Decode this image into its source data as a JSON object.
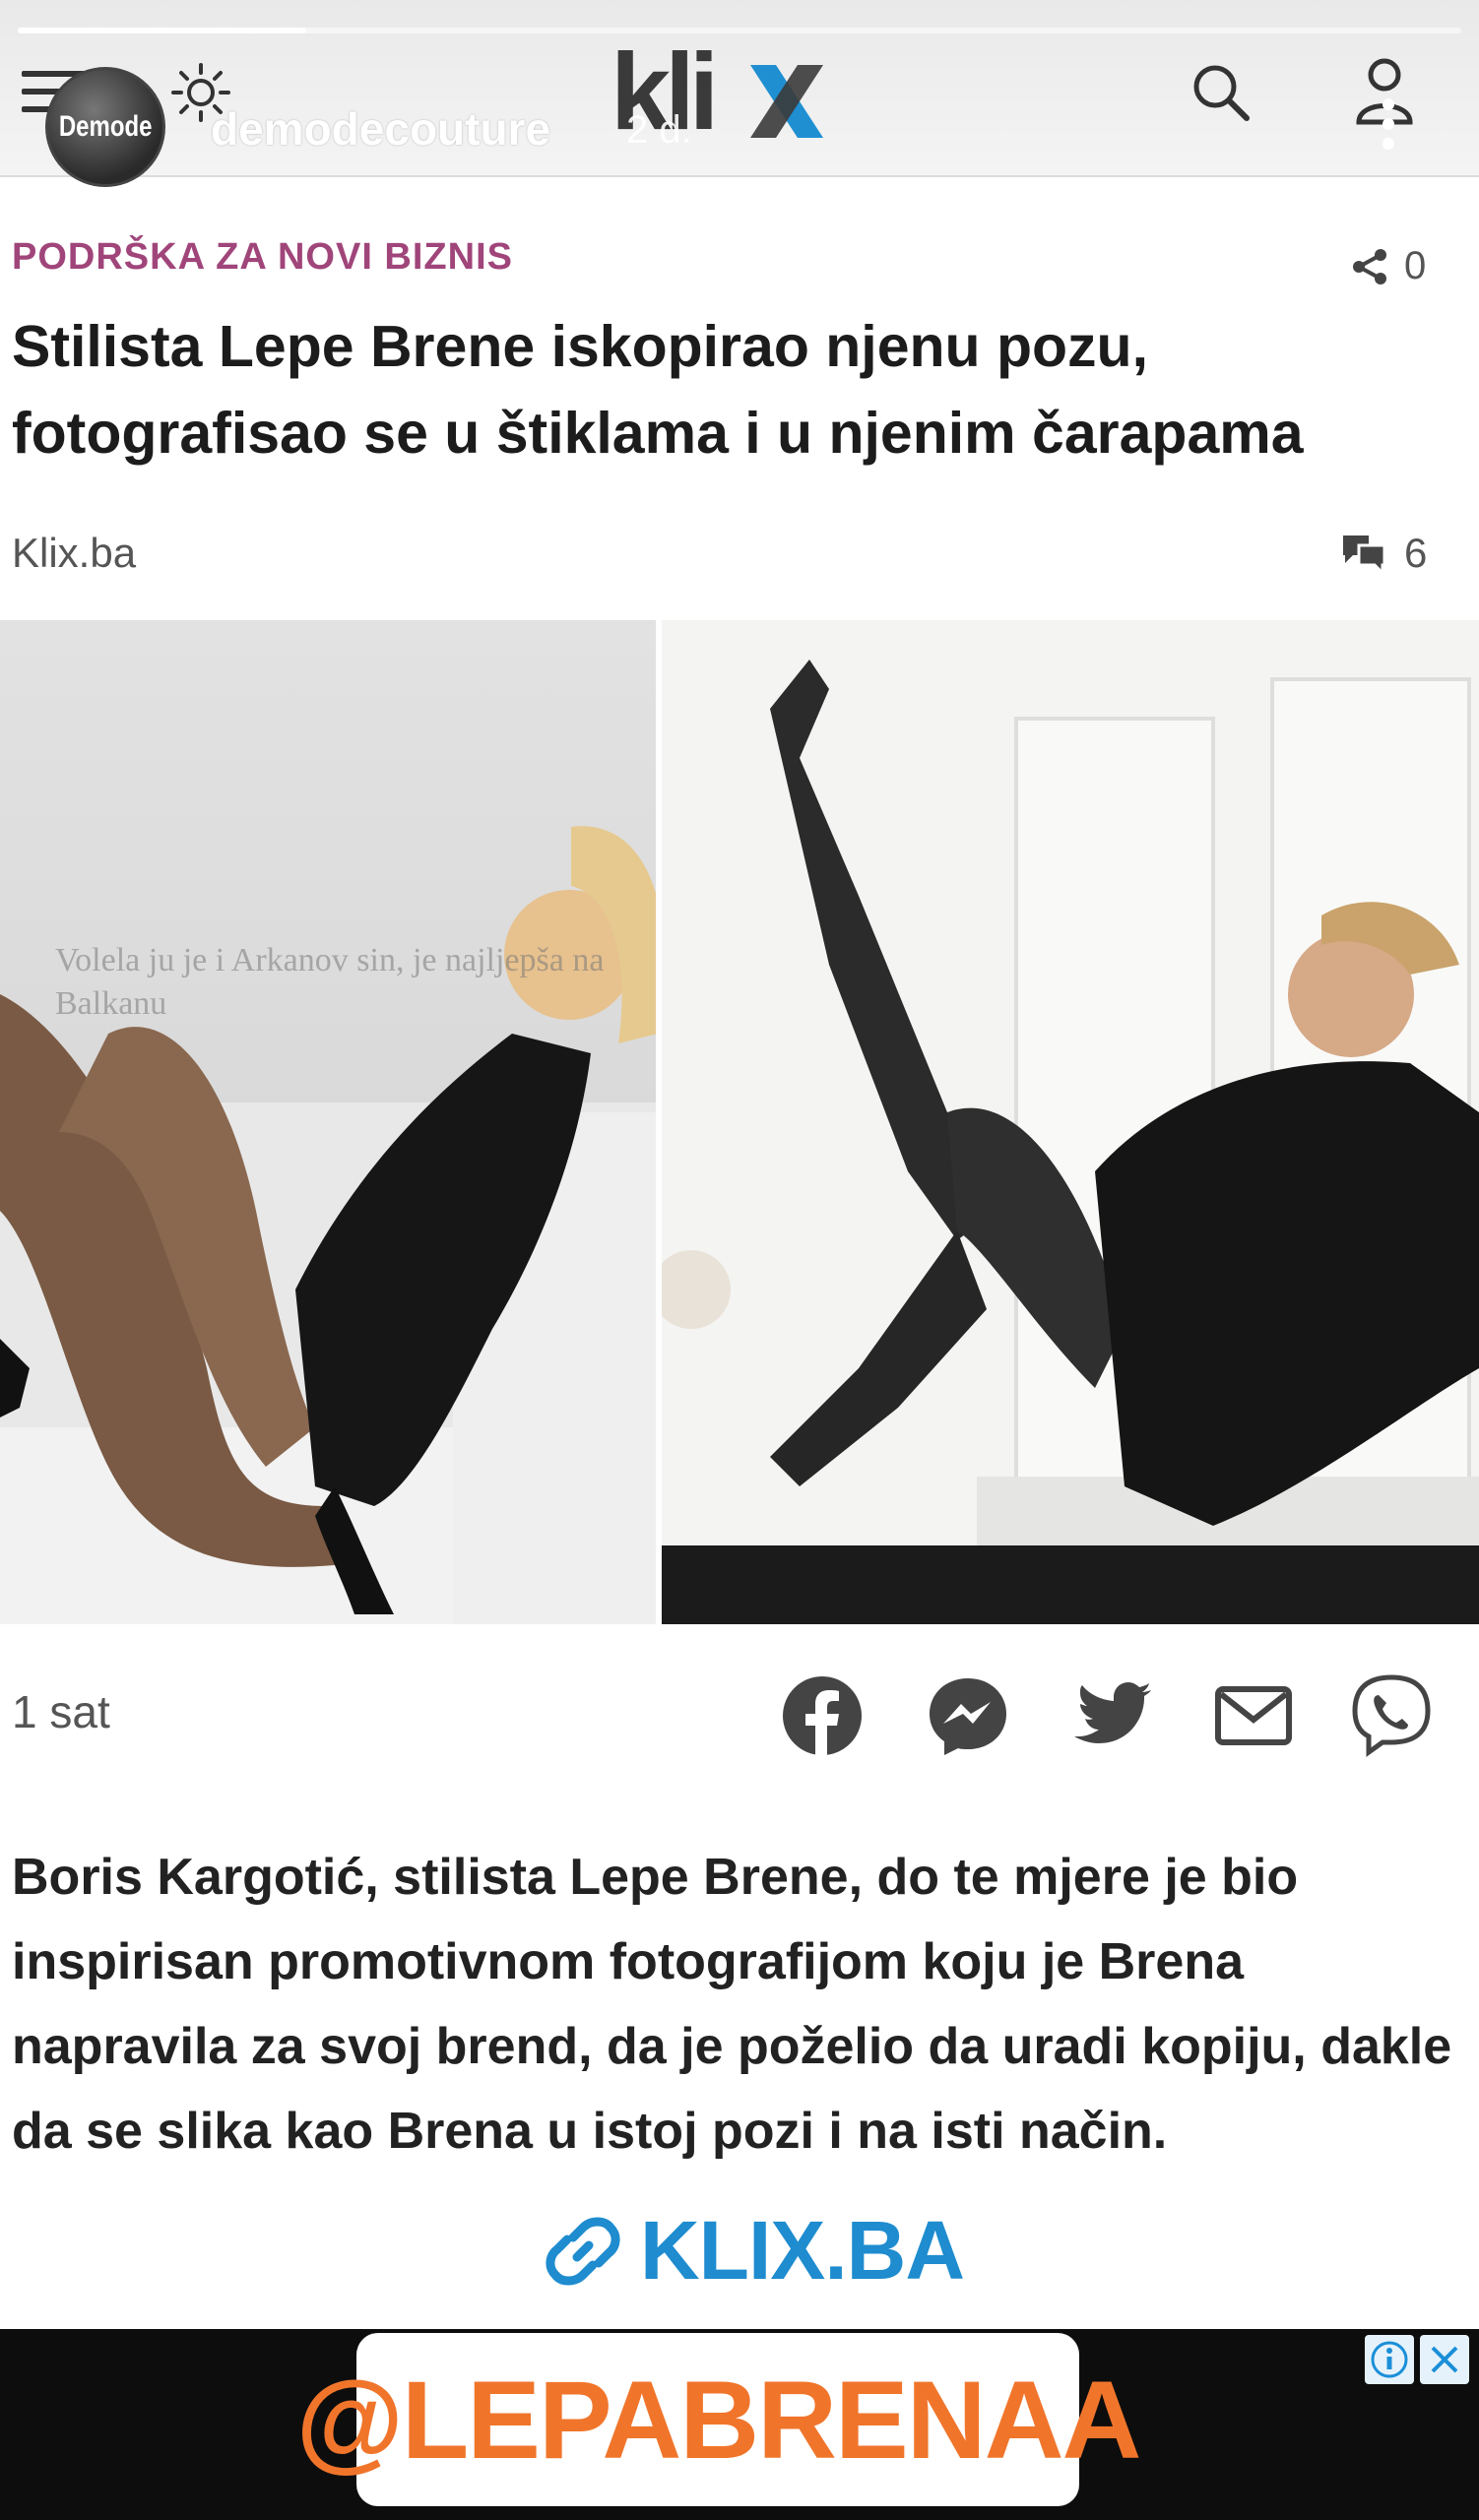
{
  "story": {
    "username": "demodecouture",
    "avatar_text": "Demode",
    "time": "2 d.",
    "progress": 0.2
  },
  "site": {
    "logo": "kli",
    "accent_color": "#1f8fd1"
  },
  "article": {
    "category": "PODRŠKA ZA NOVI BIZNIS",
    "share_count": "0",
    "headline": "Stilista Lepe Brene iskopirao njenu pozu, fotografisao se u štiklama i u njenim čarapama",
    "source": "Klix.ba",
    "comment_count": "6",
    "photo_caption": "Volela ju je i Arkanov sin, je najljepša na Balkanu",
    "time_ago": "1 sat",
    "body": "Boris Kargotić, stilista Lepe Brene, do te mjere je bio inspirisan promotivnom fotografijom koju je Brena napravila za svoj brend, da je poželio da uradi kopiju, dakle da se slika kao Brena u istoj pozi i na isti način."
  },
  "share_buttons": [
    {
      "icon": "facebook-icon"
    },
    {
      "icon": "messenger-icon"
    },
    {
      "icon": "twitter-icon"
    },
    {
      "icon": "mail-icon"
    },
    {
      "icon": "viber-icon"
    }
  ],
  "stickers": {
    "link": "KLIX.BA",
    "mention": "@LEPABRENAA",
    "mention_color": "#f0752b",
    "link_color": "#1e8ccf"
  }
}
